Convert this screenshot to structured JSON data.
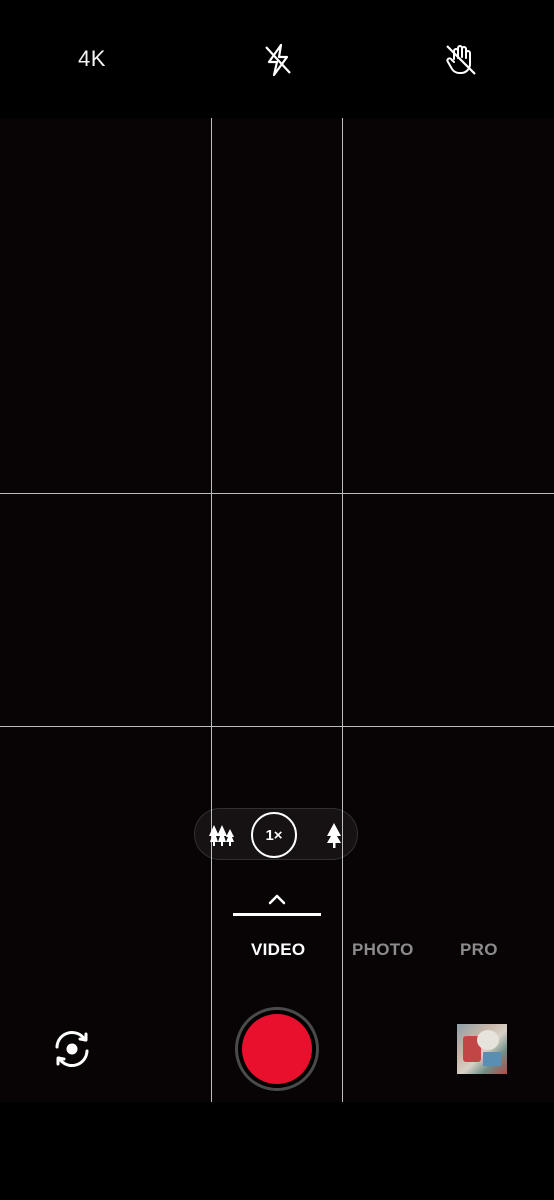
{
  "topbar": {
    "resolution_label": "4K",
    "flash_icon": "flash-off-icon",
    "gesture_icon": "gesture-off-icon"
  },
  "zoom": {
    "current_label": "1×",
    "wide_icon": "trees-wide-icon",
    "tele_icon": "tree-tele-icon"
  },
  "modes": {
    "items": [
      "VIDEO",
      "PHOTO",
      "PRO"
    ],
    "active": "VIDEO",
    "expand_icon": "chevron-up-icon"
  },
  "controls": {
    "switch_camera_icon": "switch-camera-icon",
    "record_button_color": "#e8102d",
    "gallery_thumbnail": "gallery-thumbnail"
  },
  "colors": {
    "background": "#000000",
    "viewfinder": "#080405",
    "grid": "#bdbdbd",
    "active_mode": "#ffffff",
    "inactive_mode": "#8c8c8c"
  }
}
